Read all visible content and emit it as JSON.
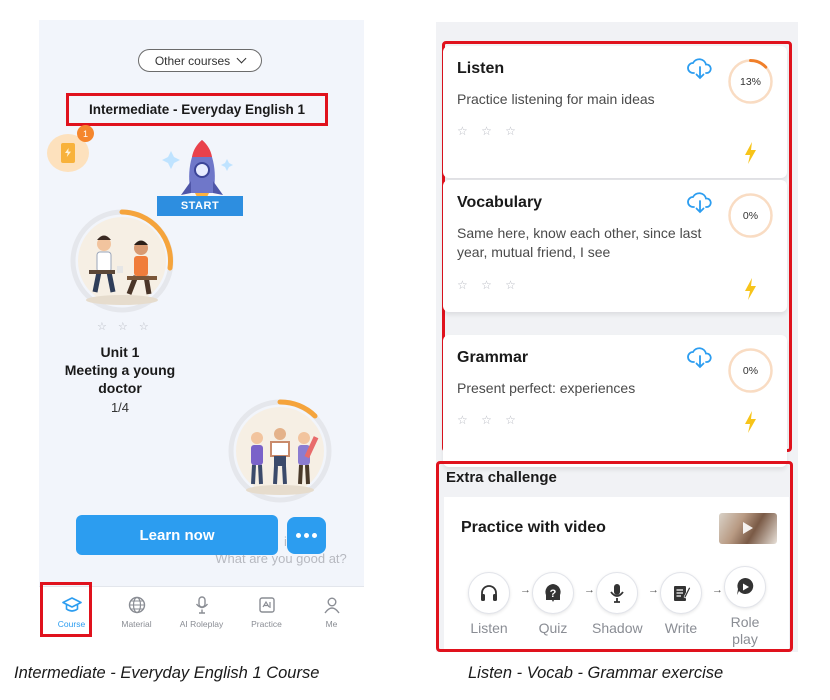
{
  "left_screen": {
    "other_courses_label": "Other courses",
    "course_title": "Intermediate - Everyday English 1",
    "energy_badge": "1",
    "start_label": "START",
    "unit": {
      "stars": "☆ ☆ ☆",
      "title": "Unit 1\nMeeting a young doctor",
      "progress": "1/4"
    },
    "learn_now_label": "Learn now",
    "ghost_text": "What are you good at?",
    "ghost_partial": "it",
    "nav": [
      {
        "label": "Course",
        "icon": "graduation-cap-icon",
        "active": true
      },
      {
        "label": "Material",
        "icon": "globe-icon",
        "active": false
      },
      {
        "label": "AI Roleplay",
        "icon": "microphone-icon",
        "active": false
      },
      {
        "label": "Practice",
        "icon": "practice-icon",
        "active": false
      },
      {
        "label": "Me",
        "icon": "person-icon",
        "active": false
      }
    ],
    "accent_color": "#2c9df0",
    "highlight_color": "#e0121d"
  },
  "right_screen": {
    "exercises": [
      {
        "title": "Listen",
        "description": "Practice listening for main ideas",
        "stars": "☆ ☆ ☆",
        "progress_label": "13%",
        "progress_fraction": 0.13
      },
      {
        "title": "Vocabulary",
        "description": "Same here, know each other, since last year, mutual friend, I see",
        "stars": "☆ ☆ ☆",
        "progress_label": "0%",
        "progress_fraction": 0
      },
      {
        "title": "Grammar",
        "description": "Present perfect: experiences",
        "stars": "☆ ☆ ☆",
        "progress_label": "0%",
        "progress_fraction": 0
      }
    ],
    "extra_challenge_title": "Extra challenge",
    "practice_video_title": "Practice with video",
    "steps": [
      {
        "label": "Listen",
        "icon": "headphones-icon"
      },
      {
        "label": "Quiz",
        "icon": "quiz-icon"
      },
      {
        "label": "Shadow",
        "icon": "microphone-icon"
      },
      {
        "label": "Write",
        "icon": "write-icon"
      },
      {
        "label": "Role play",
        "icon": "roleplay-icon"
      }
    ],
    "arrow_glyph": "→"
  },
  "captions": {
    "left": "Intermediate - Everyday English 1 Course",
    "right": "Listen - Vocab - Grammar exercise"
  }
}
